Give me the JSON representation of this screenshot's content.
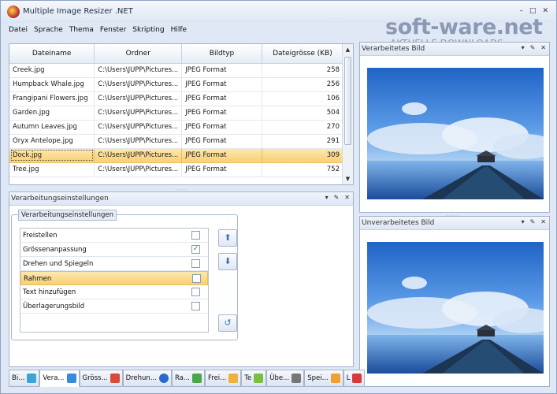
{
  "window": {
    "title": "Multiple Image Resizer .NET",
    "controls": [
      "–",
      "□",
      "✕"
    ]
  },
  "watermark": {
    "brand": "soft-ware.net",
    "subtitle": "AKTUELLE DOWNLOADS"
  },
  "menu": [
    "Datei",
    "Sprache",
    "Thema",
    "Fenster",
    "Skripting",
    "Hilfe"
  ],
  "files": {
    "columns": [
      "Dateiname",
      "Ordner",
      "Bildtyp",
      "Dateigrösse (KB)"
    ],
    "rows": [
      {
        "name": "Creek.jpg",
        "folder": "C:\\Users\\JUPP\\Pictures...",
        "type": "JPEG Format",
        "size": "258"
      },
      {
        "name": "Humpback Whale.jpg",
        "folder": "C:\\Users\\JUPP\\Pictures...",
        "type": "JPEG Format",
        "size": "256"
      },
      {
        "name": "Frangipani Flowers.jpg",
        "folder": "C:\\Users\\JUPP\\Pictures...",
        "type": "JPEG Format",
        "size": "106"
      },
      {
        "name": "Garden.jpg",
        "folder": "C:\\Users\\JUPP\\Pictures...",
        "type": "JPEG Format",
        "size": "504"
      },
      {
        "name": "Autumn Leaves.jpg",
        "folder": "C:\\Users\\JUPP\\Pictures...",
        "type": "JPEG Format",
        "size": "270"
      },
      {
        "name": "Oryx Antelope.jpg",
        "folder": "C:\\Users\\JUPP\\Pictures...",
        "type": "JPEG Format",
        "size": "291"
      },
      {
        "name": "Dock.jpg",
        "folder": "C:\\Users\\JUPP\\Pictures...",
        "type": "JPEG Format",
        "size": "309"
      },
      {
        "name": "Tree.jpg",
        "folder": "C:\\Users\\JUPP\\Pictures...",
        "type": "JPEG Format",
        "size": "752"
      }
    ],
    "selected_index": 6
  },
  "settings": {
    "panel_title": "Verarbeitungseinstellungen",
    "group_label": "Verarbeitungseinstellungen",
    "options": [
      {
        "label": "Freistellen",
        "checked": false
      },
      {
        "label": "Grössenanpassung",
        "checked": true
      },
      {
        "label": "Drehen und Spiegeln",
        "checked": false
      },
      {
        "label": "Rahmen",
        "checked": false
      },
      {
        "label": "Text hinzufügen",
        "checked": false
      },
      {
        "label": "Überlagerungsbild",
        "checked": false
      }
    ],
    "selected_option": 3,
    "check_mark": "✓"
  },
  "preview_processed": {
    "title": "Verarbeitetes Bild"
  },
  "preview_original": {
    "title": "Unverarbeitetes Bild"
  },
  "panel_controls": [
    "▾",
    "📌",
    "✕"
  ],
  "tabs": [
    {
      "label": "Bi...",
      "icon_color": "#3aa6d8",
      "active": false
    },
    {
      "label": "Vera...",
      "icon_color": "#3a8ad8",
      "active": true
    },
    {
      "label": "Gröss...",
      "icon_color": "#d84a3a",
      "active": false
    },
    {
      "label": "Drehun...",
      "icon_color": "#2a6ad0",
      "active": false
    },
    {
      "label": "Ra...",
      "icon_color": "#4aa84a",
      "active": false
    },
    {
      "label": "Frei...",
      "icon_color": "#f0b040",
      "active": false
    },
    {
      "label": "Te",
      "icon_color": "#7ac040",
      "active": false
    },
    {
      "label": "Übe...",
      "icon_color": "#777777",
      "active": false
    },
    {
      "label": "Spei...",
      "icon_color": "#f0a030",
      "active": false
    },
    {
      "label": "L",
      "icon_color": "#d83a3a",
      "active": false
    }
  ],
  "colors": {
    "selection": "#f8cf73",
    "accent": "#3d6fc4",
    "frame": "#dfe8f4"
  }
}
